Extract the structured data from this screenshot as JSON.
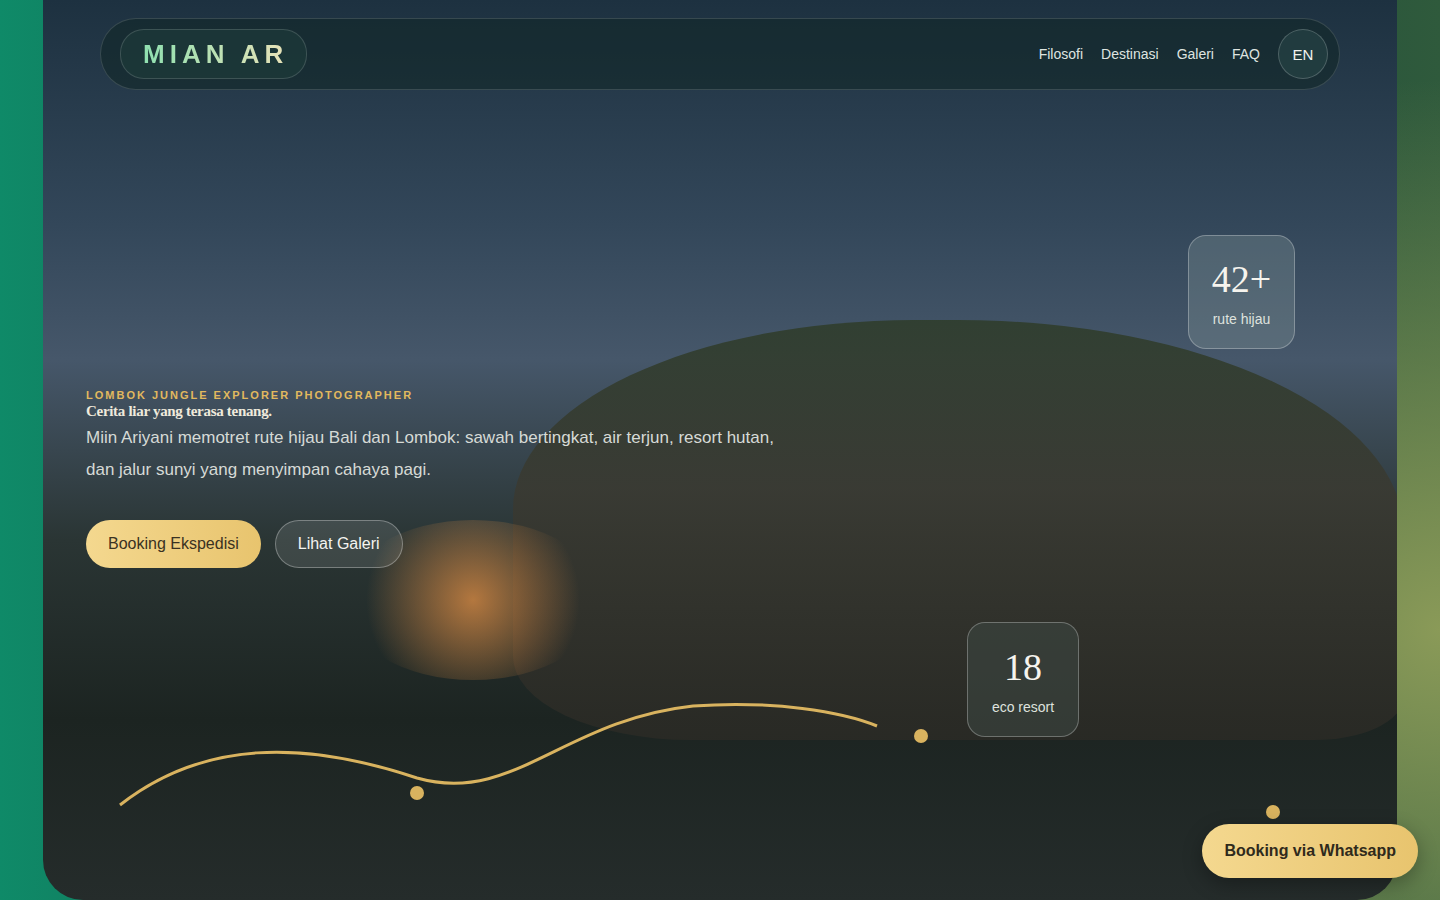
{
  "brand": {
    "logo": "MIAN AR"
  },
  "nav": {
    "links": [
      "Filosofi",
      "Destinasi",
      "Galeri",
      "FAQ"
    ],
    "language": "EN"
  },
  "hero": {
    "eyebrow": "LOMBOK JUNGLE EXPLORER PHOTOGRAPHER",
    "tagline": "Cerita liar yang terasa tenang.",
    "description": "Miin Ariyani memotret rute hijau Bali dan Lombok: sawah bertingkat, air terjun, resort hutan, dan jalur sunyi yang menyimpan cahaya pagi.",
    "buttons": [
      {
        "label": "Booking Ekspedisi",
        "kind": "primary"
      },
      {
        "label": "Lihat Galeri",
        "kind": "secondary"
      }
    ]
  },
  "stats": [
    {
      "value": "42+",
      "label": "rute hijau"
    },
    {
      "value": "18",
      "label": "eco resort"
    }
  ],
  "whatsapp": {
    "label": "Booking via Whatsapp"
  }
}
